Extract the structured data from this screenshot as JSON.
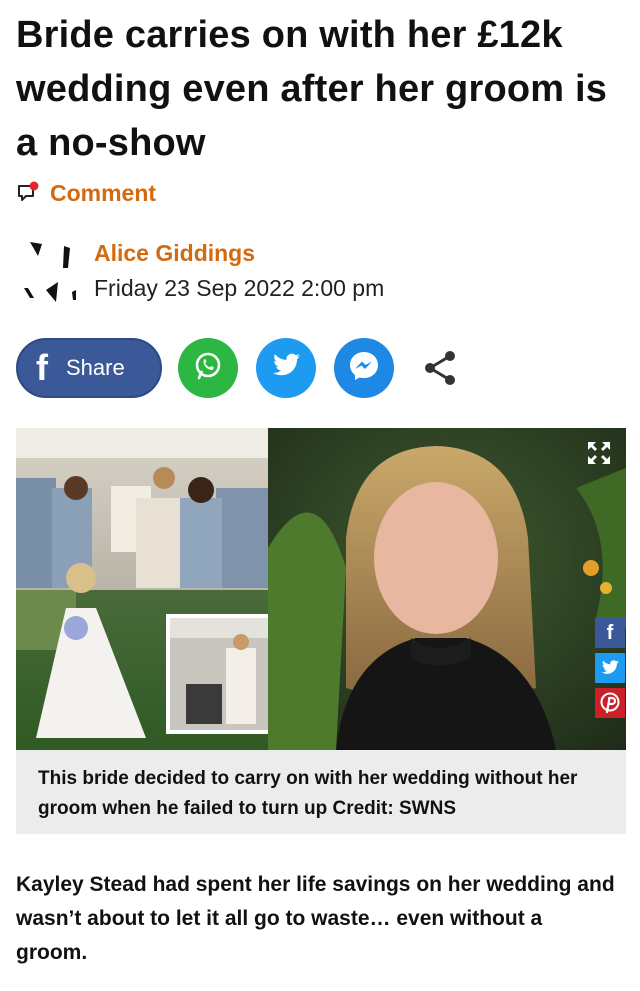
{
  "article": {
    "headline": "Bride carries on with her £12k wedding even after her groom is a no-show",
    "comment_label": "Comment",
    "comment_icon": "comment-bubble-icon",
    "author": {
      "name": "Alice Giddings",
      "date": "Friday 23 Sep 2022 2:00 pm",
      "logo_icon": "metro-logo-icon"
    },
    "share": {
      "facebook_label": "Share",
      "buttons": [
        "facebook-share",
        "whatsapp-icon",
        "twitter-icon",
        "messenger-icon",
        "share-icon"
      ]
    },
    "image": {
      "description_icon": "wedding-photo-collage",
      "expand_icon": "expand-icon",
      "side_share": [
        "facebook-icon",
        "twitter-icon",
        "pinterest-icon"
      ]
    },
    "caption": "This bride decided to carry on with her wedding without her groom when he failed to turn up Credit: SWNS",
    "lead": "Kayley Stead had spent her life savings on her wedding and wasn’t about to let it all go to waste… even without a groom."
  },
  "colors": {
    "accent_orange": "#d46a10",
    "facebook": "#3b5998",
    "whatsapp": "#2bb741",
    "twitter": "#1d9bf0",
    "messenger": "#1e88e5",
    "pinterest": "#cb2027",
    "caption_bg": "#ececec"
  }
}
